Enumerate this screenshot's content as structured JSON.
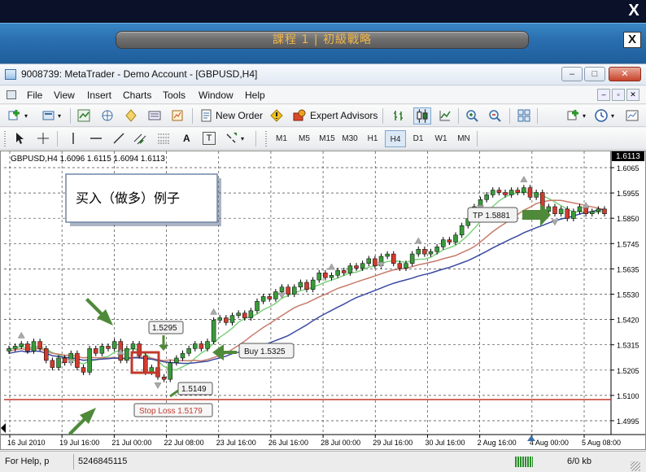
{
  "course": {
    "title": "課程 1 | 初級戰略",
    "close_label": "X",
    "top_close_label": "X"
  },
  "window": {
    "title": "9008739: MetaTrader - Demo Account - [GBPUSD,H4]",
    "min_label": "–",
    "max_label": "□",
    "close_label": "✕"
  },
  "menu": [
    "File",
    "View",
    "Insert",
    "Charts",
    "Tools",
    "Window",
    "Help"
  ],
  "toolbar": {
    "new_order": "New Order",
    "expert_advisors": "Expert Advisors",
    "timeframes": [
      "M1",
      "M5",
      "M15",
      "M30",
      "H1",
      "H4",
      "D1",
      "W1",
      "MN"
    ],
    "active_timeframe": "H4",
    "draw_labels": {
      "text": "A",
      "textlabel": "T"
    }
  },
  "chart": {
    "header": "GBPUSD,H4  1.6096 1.6115 1.6094 1.6113",
    "current_price": "1.6113",
    "price_ticks": [
      "1.6065",
      "1.5955",
      "1.5850",
      "1.5745",
      "1.5635",
      "1.5530",
      "1.5420",
      "1.5315",
      "1.5205",
      "1.5100",
      "1.4995"
    ],
    "date_ticks": [
      "16 Jul 2010",
      "19 Jul 16:00",
      "21 Jul 00:00",
      "22 Jul 08:00",
      "23 Jul 16:00",
      "26 Jul 16:00",
      "28 Jul 00:00",
      "29 Jul 16:00",
      "30 Jul 16:00",
      "2 Aug 16:00",
      "4 Aug 00:00",
      "5 Aug 08:00"
    ],
    "annotations": {
      "example_box": "买入（做多）例子",
      "tp_label": "TP 1.5881",
      "buy_label": "Buy 1.5325",
      "high_label": "1.5295",
      "low_label": "1.5149",
      "stop_loss_label": "Stop Loss 1.5179"
    },
    "colors": {
      "up": "#3a9a3a",
      "down": "#d23b2e",
      "ma_fast": "#7ed27e",
      "ma_mid": "#c77b6b",
      "ma_slow": "#3b4aa0",
      "stop_line": "#c0392b"
    }
  },
  "status": {
    "help": "For Help, p",
    "id": "5246845115",
    "kb": "6/0 kb"
  }
}
